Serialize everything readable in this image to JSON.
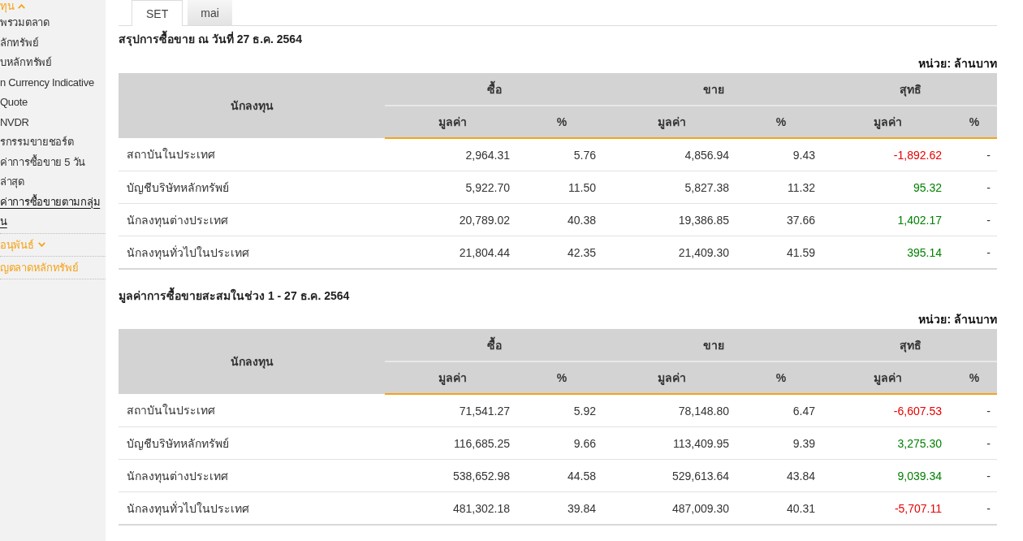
{
  "sidebar": {
    "items": [
      {
        "kind": "group",
        "text": "ทุน",
        "expanded": true,
        "children": [
          {
            "text": "พรวมตลาด",
            "selected": false
          },
          {
            "text": "ลักทรัพย์",
            "selected": false
          },
          {
            "text": "บหลักทรัพย์",
            "selected": false
          },
          {
            "text": "n Currency Indicative\nQuote",
            "selected": false
          },
          {
            "text": "NVDR",
            "selected": false
          },
          {
            "text": "รกรรมขายชอร์ต",
            "selected": false
          },
          {
            "text": "ค่าการซื้อขาย 5 วัน\nล่าสุด",
            "selected": false
          },
          {
            "text": "ค่าการซื้อขายตามกลุ่ม\nน",
            "selected": true
          }
        ]
      },
      {
        "kind": "group",
        "text": "อนุพันธ์",
        "expanded": false
      },
      {
        "kind": "link",
        "text": "ญตลาดหลักทรัพย์"
      }
    ]
  },
  "tabs": [
    {
      "label": "SET",
      "selected": true
    },
    {
      "label": "mai",
      "selected": false
    }
  ],
  "sections": [
    {
      "title": "สรุปการซื้อขาย ณ วันที่ 27 ธ.ค. 2564",
      "unit": "หน่วย: ล้านบาท",
      "table": {
        "header": "นักลงทุน",
        "groups": [
          {
            "label": "ซื้อ",
            "columns": [
              "มูลค่า",
              "%"
            ]
          },
          {
            "label": "ขาย",
            "columns": [
              "มูลค่า",
              "%"
            ]
          },
          {
            "label": "สุทธิ",
            "columns": [
              "มูลค่า",
              "%"
            ]
          }
        ],
        "rows": [
          {
            "investor": "สถาบันในประเทศ",
            "cells": [
              "2,964.31",
              "5.76",
              "4,856.94",
              "9.43",
              "-1,892.62",
              "-"
            ],
            "color": "#e60000"
          },
          {
            "investor": "บัญชีบริษัทหลักทรัพย์",
            "cells": [
              "5,922.70",
              "11.50",
              "5,827.38",
              "11.32",
              "95.32",
              "-"
            ],
            "color": "#008000"
          },
          {
            "investor": "นักลงทุนต่างประเทศ",
            "cells": [
              "20,789.02",
              "40.38",
              "19,386.85",
              "37.66",
              "1,402.17",
              "-"
            ],
            "color": "#008000"
          },
          {
            "investor": "นักลงทุนทั่วไปในประเทศ",
            "cells": [
              "21,804.44",
              "42.35",
              "21,409.30",
              "41.59",
              "395.14",
              "-"
            ],
            "color": "#008000"
          }
        ]
      }
    },
    {
      "title": "มูลค่าการซื้อขายสะสมในช่วง 1 - 27 ธ.ค. 2564",
      "unit": "หน่วย: ล้านบาท",
      "table": {
        "header": "นักลงทุน",
        "groups": [
          {
            "label": "ซื้อ",
            "columns": [
              "มูลค่า",
              "%"
            ]
          },
          {
            "label": "ขาย",
            "columns": [
              "มูลค่า",
              "%"
            ]
          },
          {
            "label": "สุทธิ",
            "columns": [
              "มูลค่า",
              "%"
            ]
          }
        ],
        "rows": [
          {
            "investor": "สถาบันในประเทศ",
            "cells": [
              "71,541.27",
              "5.92",
              "78,148.80",
              "6.47",
              "-6,607.53",
              "-"
            ],
            "color": "#e60000"
          },
          {
            "investor": "บัญชีบริษัทหลักทรัพย์",
            "cells": [
              "116,685.25",
              "9.66",
              "113,409.95",
              "9.39",
              "3,275.30",
              "-"
            ],
            "color": "#008000"
          },
          {
            "investor": "นักลงทุนต่างประเทศ",
            "cells": [
              "538,652.98",
              "44.58",
              "529,613.64",
              "43.84",
              "9,039.34",
              "-"
            ],
            "color": "#008000"
          },
          {
            "investor": "นักลงทุนทั่วไปในประเทศ",
            "cells": [
              "481,302.18",
              "39.84",
              "487,009.30",
              "40.31",
              "-5,707.11",
              "-"
            ],
            "color": "#e60000"
          }
        ]
      }
    }
  ]
}
